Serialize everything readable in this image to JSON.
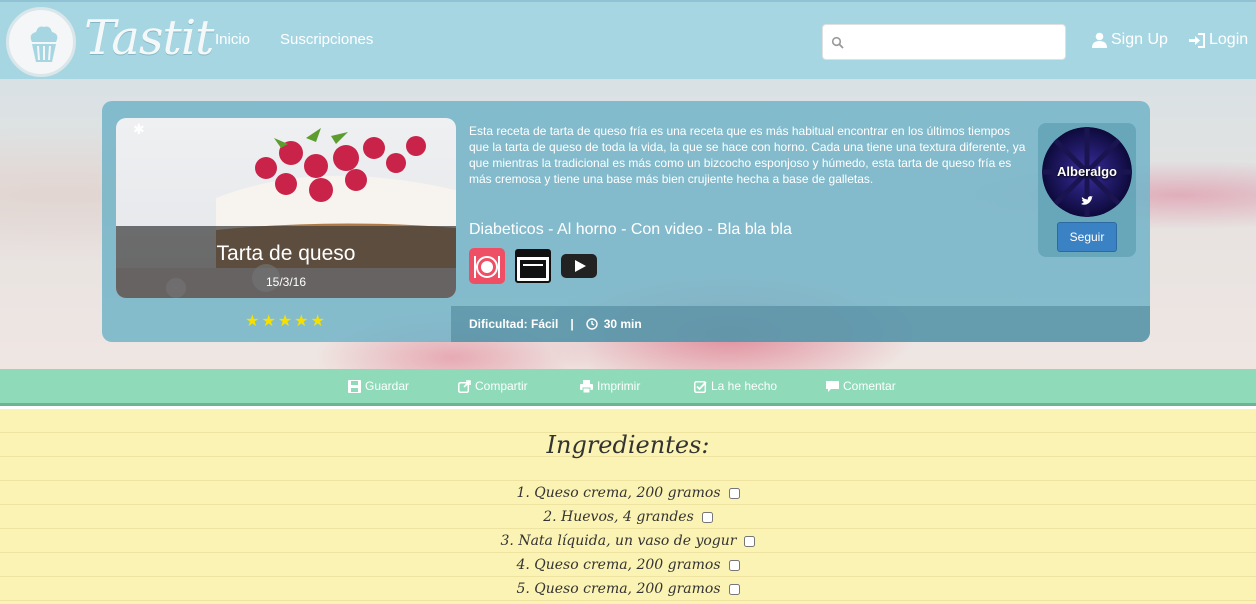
{
  "nav": {
    "logo": "Tastit",
    "links": [
      "Inicio",
      "Suscripciones"
    ],
    "search_placeholder": "",
    "signup": "Sign Up",
    "login": "Login"
  },
  "recipe": {
    "title": "Tarta de queso",
    "date": "15/3/16",
    "rating": 5,
    "stars": "★★★★★",
    "description": "Esta receta de tarta de queso fría es una receta que es más habitual encontrar en los últimos tiempos que la tarta de queso de toda la vida, la que se hace con horno. Cada una tiene una textura diferente, ya que mientras la tradicional es más como un bizcocho esponjoso y húmedo, esta tarta de queso fría es más cremosa y tiene una base más bien crujiente hecha a base de galletas.",
    "tags": "Diabeticos - Al horno - Con video - Bla bla bla",
    "tag_icons": [
      "plate-icon",
      "oven-icon",
      "video-play-icon"
    ],
    "difficulty": "Dificultad: Fácil",
    "separator": "|",
    "time": "30 min"
  },
  "author": {
    "name": "Alberalgo",
    "follow_label": "Seguir"
  },
  "actions": [
    {
      "label": "Guardar",
      "icon": "save-icon"
    },
    {
      "label": "Compartir",
      "icon": "share-icon"
    },
    {
      "label": "Imprimir",
      "icon": "print-icon"
    },
    {
      "label": "La he hecho",
      "icon": "check-icon"
    },
    {
      "label": "Comentar",
      "icon": "comment-icon"
    }
  ],
  "ingredients": {
    "title": "Ingredientes:",
    "items": [
      "1. Queso crema, 200 gramos",
      "2. Huevos, 4 grandes",
      "3. Nata líquida, un vaso de yogur",
      "4. Queso crema, 200 gramos",
      "5. Queso crema, 200 gramos"
    ]
  },
  "colors": {
    "navbar": "#a7d6e3",
    "card": "#73b4c8",
    "actions_bar": "#8fdab9",
    "paper": "#fbf3b3",
    "stars": "#f5e000",
    "follow_button": "#3b82c4"
  }
}
